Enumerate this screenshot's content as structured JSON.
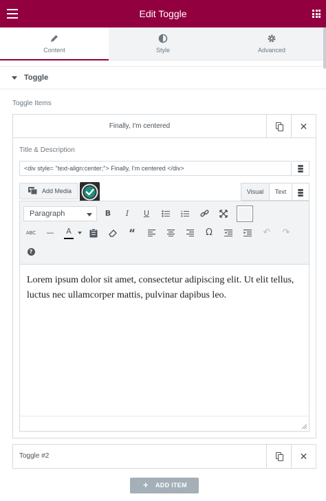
{
  "header": {
    "title": "Edit Toggle",
    "menu_icon": "hamburger-icon",
    "apps_icon": "grid-icon",
    "accent_color": "#93003f"
  },
  "tabs": [
    {
      "label": "Content",
      "icon": "pencil-icon",
      "active": true
    },
    {
      "label": "Style",
      "icon": "half-circle-icon",
      "active": false
    },
    {
      "label": "Advanced",
      "icon": "gear-icon",
      "active": false
    }
  ],
  "section": {
    "title": "Toggle",
    "items_label": "Toggle Items"
  },
  "items": [
    {
      "title": "Finally, I'm centered",
      "field_label": "Title & Description",
      "field_value": "<div style= \"text-align:center;\"> Finally, I'm centered </div>",
      "add_media_label": "Add Media",
      "editor_tabs": {
        "visual": "Visual",
        "text": "Text"
      },
      "format_select": "Paragraph",
      "content": "Lorem ipsum dolor sit amet, consectetur adipiscing elit. Ut elit tellus, luctus nec ullamcorper mattis, pulvinar dapibus leo."
    },
    {
      "title": "Toggle #2"
    }
  ],
  "add_item_label": "ADD ITEM"
}
